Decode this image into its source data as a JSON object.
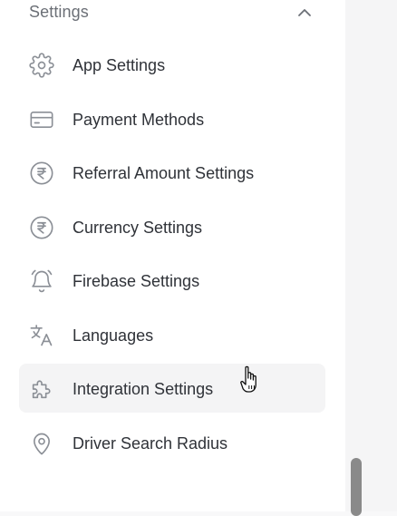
{
  "section": {
    "title": "Settings",
    "expanded": true
  },
  "menu": {
    "items": [
      {
        "label": "App Settings",
        "icon": "gear-icon"
      },
      {
        "label": "Payment Methods",
        "icon": "credit-card-icon"
      },
      {
        "label": "Referral Amount Settings",
        "icon": "rupee-coin-icon"
      },
      {
        "label": "Currency Settings",
        "icon": "rupee-coin-icon"
      },
      {
        "label": "Firebase Settings",
        "icon": "bell-icon"
      },
      {
        "label": "Languages",
        "icon": "translate-icon"
      },
      {
        "label": "Integration Settings",
        "icon": "puzzle-icon",
        "hovered": true
      },
      {
        "label": "Driver Search Radius",
        "icon": "map-pin-icon"
      }
    ]
  },
  "colors": {
    "icon_stroke": "#8b8f96",
    "label_text": "#2f3238",
    "section_title": "#6b6f76",
    "hover_bg": "#f4f4f5",
    "scrollbar": "#8a8a8a"
  }
}
